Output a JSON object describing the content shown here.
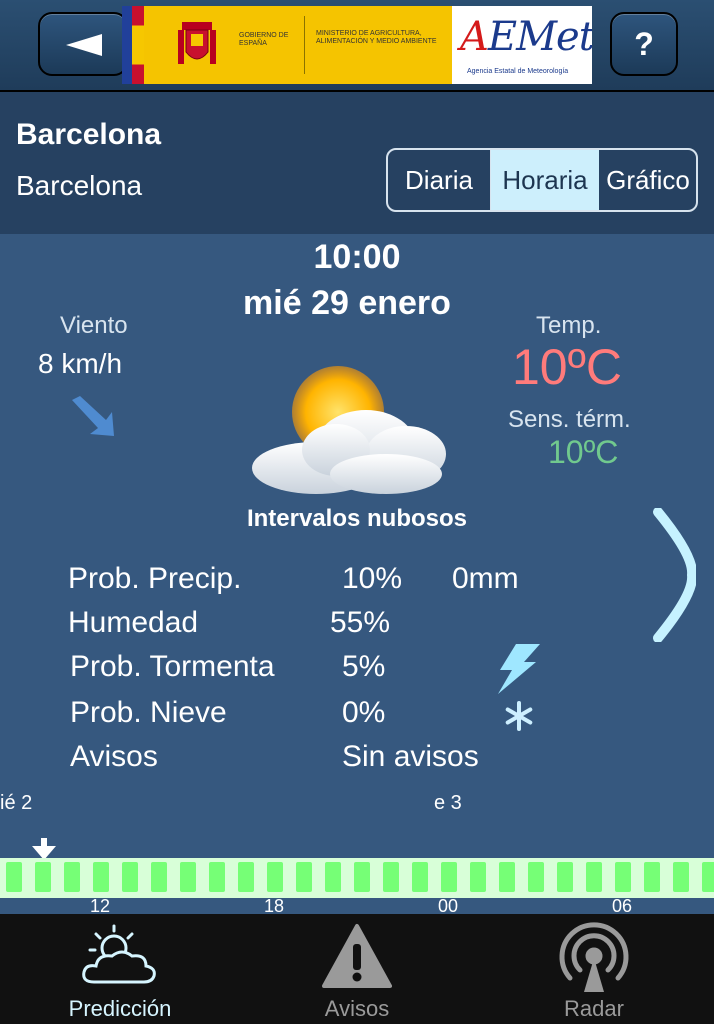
{
  "header": {
    "back_icon": "back-arrow-icon",
    "help_label": "?",
    "banner": {
      "gov_text": "GOBIERNO DE ESPAÑA",
      "ministry_text": "MINISTERIO DE AGRICULTURA, ALIMENTACIÓN Y MEDIO AMBIENTE",
      "logo_text": "AEMet",
      "logo_sub": "Agencia Estatal de Meteorología"
    }
  },
  "location": {
    "city": "Barcelona",
    "subtitle": "Barcelona"
  },
  "view_tabs": [
    {
      "label": "Diaria"
    },
    {
      "label": "Horaria",
      "selected": true
    },
    {
      "label": "Gráfico"
    }
  ],
  "forecast": {
    "hour": "10:00",
    "date": "mié 29 enero",
    "wind_label": "Viento",
    "wind_value": "8 km/h",
    "temp_label": "Temp.",
    "temp_value": "10ºC",
    "feels_label": "Sens. térm.",
    "feels_value": "10ºC",
    "condition": "Intervalos nubosos",
    "details": [
      {
        "label": "Prob. Precip.",
        "value": "10%",
        "extra": "0mm"
      },
      {
        "label": "Humedad",
        "value": "55%"
      },
      {
        "label": "Prob. Tormenta",
        "value": "5%",
        "icon": "lightning-icon"
      },
      {
        "label": "Prob. Nieve",
        "value": "0%",
        "icon": "snowflake-icon"
      },
      {
        "label": "Avisos",
        "value": "Sin avisos"
      }
    ]
  },
  "timeline": {
    "day_left": "ié 2",
    "day_mid": "e 3",
    "hours": [
      "12",
      "18",
      "00",
      "06"
    ]
  },
  "tabbar": [
    {
      "label": "Predicción",
      "icon": "sun-cloud-icon",
      "active": true
    },
    {
      "label": "Avisos",
      "icon": "warning-icon"
    },
    {
      "label": "Radar",
      "icon": "radar-icon"
    }
  ],
  "colors": {
    "temp": "#ff7b7b",
    "feels": "#71c98e",
    "accent": "#cdeffc",
    "timeline_tick": "#76ff76"
  }
}
